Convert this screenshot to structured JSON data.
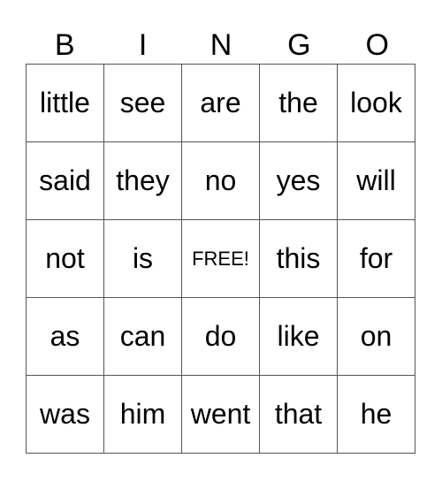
{
  "header": [
    "B",
    "I",
    "N",
    "G",
    "O"
  ],
  "rows": [
    [
      "little",
      "see",
      "are",
      "the",
      "look"
    ],
    [
      "said",
      "they",
      "no",
      "yes",
      "will"
    ],
    [
      "not",
      "is",
      "FREE!",
      "this",
      "for"
    ],
    [
      "as",
      "can",
      "do",
      "like",
      "on"
    ],
    [
      "was",
      "him",
      "went",
      "that",
      "he"
    ]
  ]
}
